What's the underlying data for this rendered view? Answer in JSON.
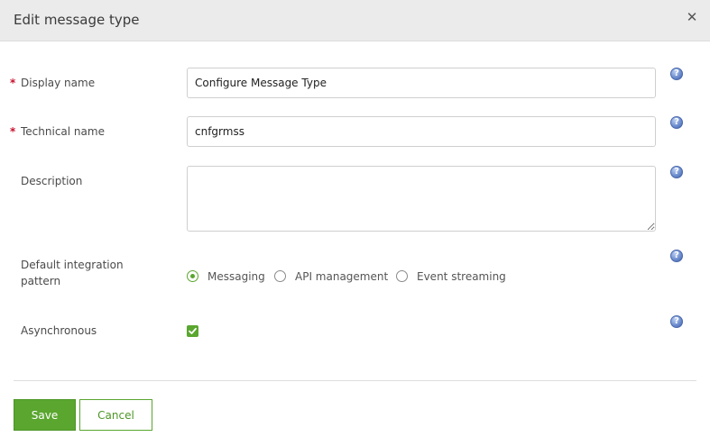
{
  "dialog": {
    "title": "Edit message type",
    "close_icon": "close-icon",
    "close_glyph": "✕"
  },
  "form": {
    "required_marker": "*",
    "help_icon": "help-icon",
    "help_glyph": "?",
    "display_name": {
      "label": "Display name",
      "value": "Configure Message Type",
      "required": true
    },
    "technical_name": {
      "label": "Technical name",
      "value": "cnfgrmss",
      "required": true
    },
    "description": {
      "label": "Description",
      "value": ""
    },
    "integration_pattern": {
      "label_line1": "Default integration",
      "label_line2": "pattern",
      "options": [
        {
          "label": "Messaging",
          "checked": true
        },
        {
          "label": "API management",
          "checked": false
        },
        {
          "label": "Event streaming",
          "checked": false
        }
      ]
    },
    "asynchronous": {
      "label": "Asynchronous",
      "checked": true
    }
  },
  "footer": {
    "save_label": "Save",
    "cancel_label": "Cancel"
  },
  "colors": {
    "accent": "#5aa62f",
    "required": "#c8102e",
    "header_bg": "#ebebeb"
  }
}
